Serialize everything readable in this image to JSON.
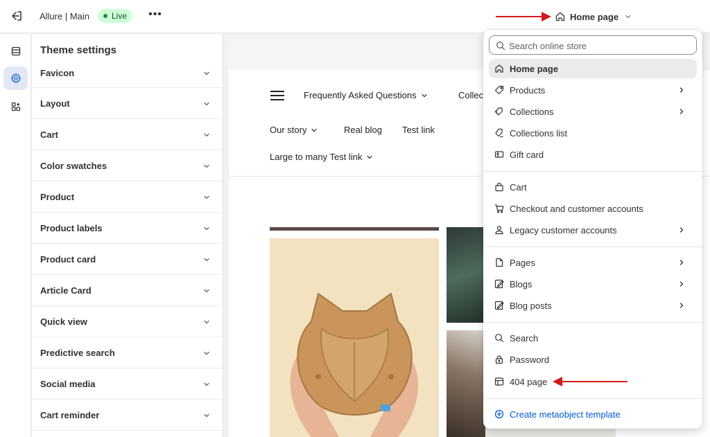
{
  "topbar": {
    "store_name": "Allure | Main",
    "live_label": "Live",
    "more_label": "•••",
    "page_picker_label": "Home page"
  },
  "panel": {
    "title": "Theme settings",
    "sections": [
      {
        "label": "Favicon"
      },
      {
        "label": "Layout"
      },
      {
        "label": "Cart"
      },
      {
        "label": "Color swatches"
      },
      {
        "label": "Product"
      },
      {
        "label": "Product labels"
      },
      {
        "label": "Product card"
      },
      {
        "label": "Article Card"
      },
      {
        "label": "Quick view"
      },
      {
        "label": "Predictive search"
      },
      {
        "label": "Social media"
      },
      {
        "label": "Cart reminder"
      }
    ]
  },
  "preview": {
    "nav": {
      "faq": "Frequently Asked Questions",
      "collections": "Collec",
      "our_story": "Our story",
      "real_blog": "Real blog",
      "test_link": "Test link",
      "large_link": "Large to many Test link"
    }
  },
  "dropdown": {
    "search_placeholder": "Search online store",
    "items": {
      "home_page": "Home page",
      "products": "Products",
      "collections": "Collections",
      "collections_list": "Collections list",
      "gift_card": "Gift card",
      "cart": "Cart",
      "checkout": "Checkout and customer accounts",
      "legacy": "Legacy customer accounts",
      "pages": "Pages",
      "blogs": "Blogs",
      "blog_posts": "Blog posts",
      "search": "Search",
      "password": "Password",
      "page_404": "404 page",
      "create_metaobject": "Create metaobject template"
    }
  },
  "colors": {
    "accent_link": "#005bd3",
    "live_badge_bg": "#cdfed4",
    "annotation_arrow": "#d21a1a"
  }
}
